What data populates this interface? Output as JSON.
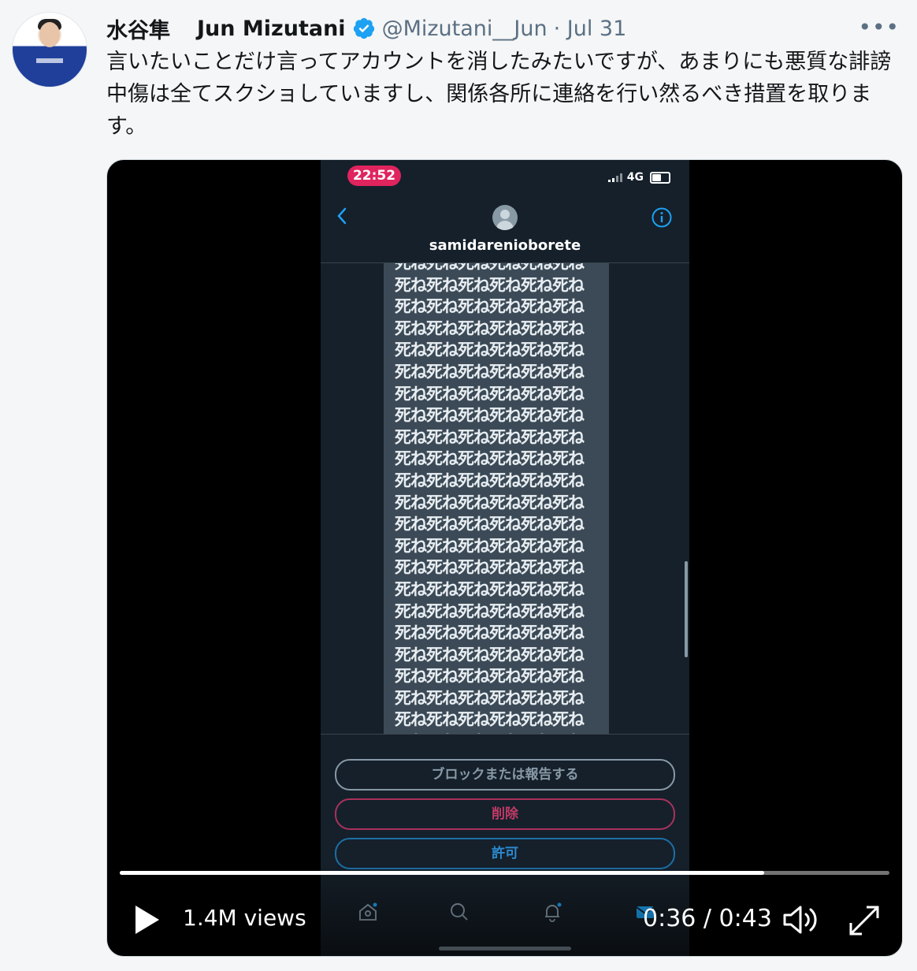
{
  "author": {
    "name_jp": "水谷隼",
    "name_en": "Jun Mizutani",
    "handle": "@Mizutani__Jun",
    "date": "· Jul 31",
    "verified": true
  },
  "tweet": {
    "text": "言いたいことだけ言ってアカウントを消したみたいですが、あまりにも悪質な誹謗中傷は全てスクショしていますし、関係各所に連絡を行い然るべき措置を取ります。"
  },
  "video": {
    "views": "1.4M views",
    "time": "0:36 / 0:43",
    "progress": 0.837,
    "phone": {
      "status_time": "22:52",
      "network": "4G",
      "dm_username": "samidarenioborete",
      "message_text": "死ね死ね死ね死ね死ね死ね\n死ね死ね死ね死ね死ね死ね\n死ね死ね死ね死ね死ね死ね\n死ね死ね死ね死ね死ね死ね\n死ね死ね死ね死ね死ね死ね\n死ね死ね死ね死ね死ね死ね\n死ね死ね死ね死ね死ね死ね\n死ね死ね死ね死ね死ね死ね\n死ね死ね死ね死ね死ね死ね\n死ね死ね死ね死ね死ね死ね\n死ね死ね死ね死ね死ね死ね\n死ね死ね死ね死ね死ね死ね\n死ね死ね死ね死ね死ね死ね\n死ね死ね死ね死ね死ね死ね\n死ね死ね死ね死ね死ね死ね\n死ね死ね死ね死ね死ね死ね\n死ね死ね死ね死ね死ね死ね\n死ね死ね死ね死ね死ね死ね\n死ね死ね死ね死ね死ね死ね\n死ね死ね死ね死ね死ね死ね\n死ね死ね死ね死ね死ね死ね\n死ね死ね死ね死ね死ね死ね\n死ね死ね死ね死ね死ね死ね",
      "block_report_label": "ブロックまたは報告する",
      "delete_label": "削除",
      "allow_label": "許可"
    }
  },
  "icons": {
    "verified": "verified-badge-icon",
    "more": "more-icon",
    "play": "play-icon",
    "volume": "volume-icon",
    "fullscreen": "fullscreen-icon"
  },
  "colors": {
    "verified_blue": "#1da1f2",
    "delete_red": "#e0245e",
    "rec_red": "#e0245e"
  }
}
